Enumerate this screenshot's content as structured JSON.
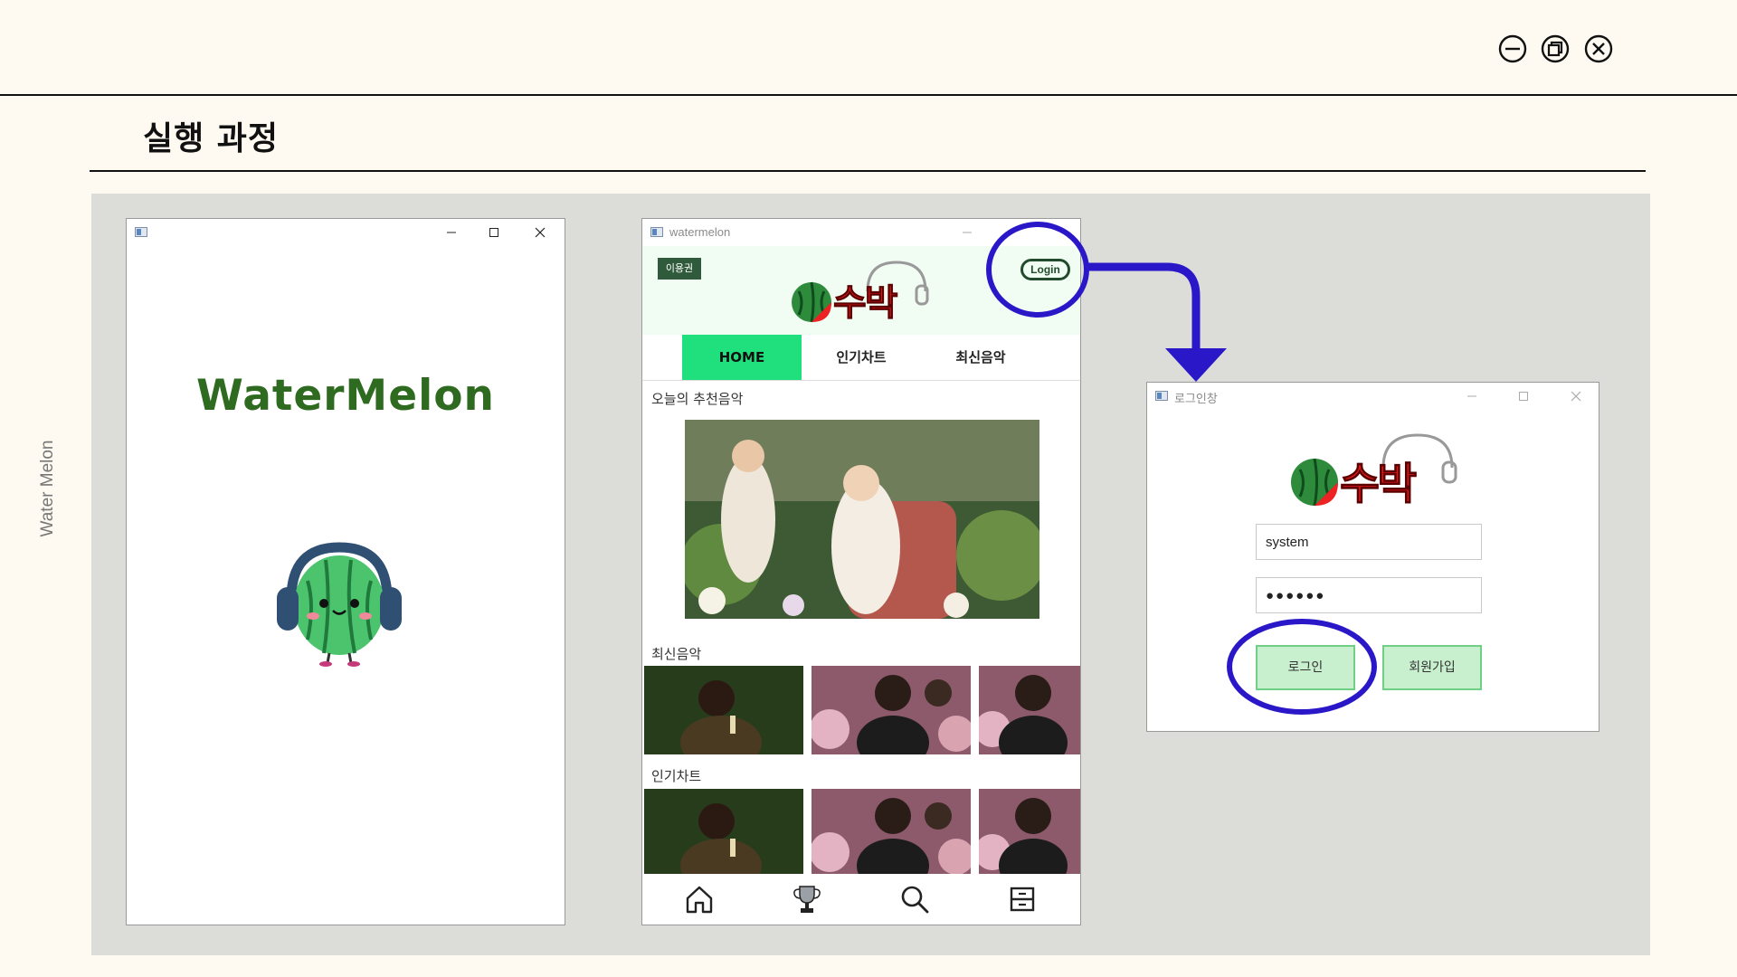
{
  "slide": {
    "title": "실행 과정",
    "side_label": "Water Melon",
    "controls": [
      "minimize-icon",
      "restore-icon",
      "close-icon"
    ]
  },
  "colors": {
    "background": "#fefaf1",
    "panel": "#dcdcd9",
    "accent_green": "#1fe07d",
    "highlight_blue": "#2a18c8",
    "button_green": "#c8f0cf"
  },
  "splash_window": {
    "title": "",
    "app_name": "WaterMelon"
  },
  "main_window": {
    "title": "watermelon",
    "ticket_label": "이용권",
    "logo_text": "수박",
    "login_label": "Login",
    "tabs": [
      {
        "label": "HOME",
        "active": true
      },
      {
        "label": "인기차트",
        "active": false
      },
      {
        "label": "최신음악",
        "active": false
      }
    ],
    "sections": {
      "recommended": "오늘의 추천음악",
      "latest": "최신음악",
      "chart": "인기차트"
    },
    "bottom_nav": [
      "home-icon",
      "trophy-icon",
      "search-icon",
      "archive-icon"
    ]
  },
  "login_window": {
    "title": "로그인창",
    "logo_text": "수박",
    "username_value": "system",
    "password_value": "●●●●●●",
    "login_label": "로그인",
    "signup_label": "회원가입"
  }
}
